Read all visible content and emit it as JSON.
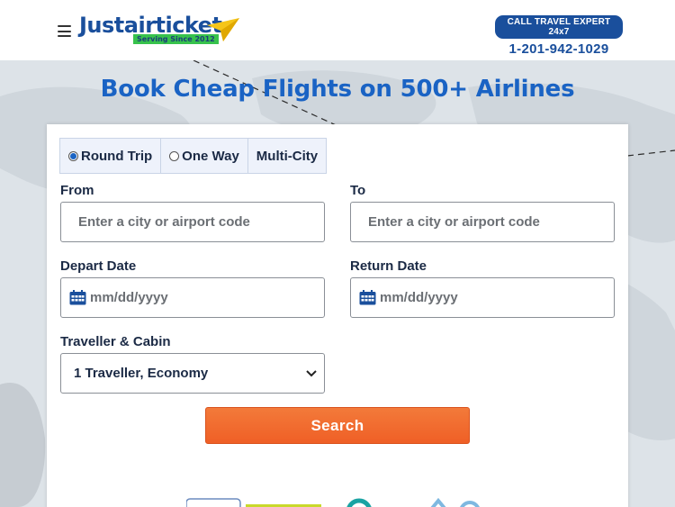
{
  "header": {
    "logo_text": "Justairticket",
    "logo_tagline": "Serving Since 2012",
    "call_badge": "CALL TRAVEL EXPERT 24x7",
    "phone": "1-201-942-1029"
  },
  "hero": {
    "title": "Book Cheap Flights on 500+ Airlines"
  },
  "search_form": {
    "trip_types": [
      {
        "label": "Round Trip",
        "checked": true
      },
      {
        "label": "One Way",
        "checked": false
      },
      {
        "label": "Multi-City",
        "checked": false
      }
    ],
    "from": {
      "label": "From",
      "placeholder": "Enter a city or airport code"
    },
    "to": {
      "label": "To",
      "placeholder": "Enter a city or airport code"
    },
    "depart": {
      "label": "Depart Date",
      "placeholder": "mm/dd/yyyy"
    },
    "return": {
      "label": "Return Date",
      "placeholder": "mm/dd/yyyy"
    },
    "traveller": {
      "label": "Traveller & Cabin",
      "value": "1 Traveller, Economy"
    },
    "search_label": "Search"
  },
  "colors": {
    "brand_blue": "#1a4f9c",
    "hero_blue": "#1a63c4",
    "search_orange": "#ef5f26",
    "logo_green": "#37c24c",
    "plane_yellow": "#f5c518"
  },
  "icons": [
    "hamburger-menu-icon",
    "paper-plane-icon",
    "calendar-icon",
    "chevron-down-icon"
  ]
}
